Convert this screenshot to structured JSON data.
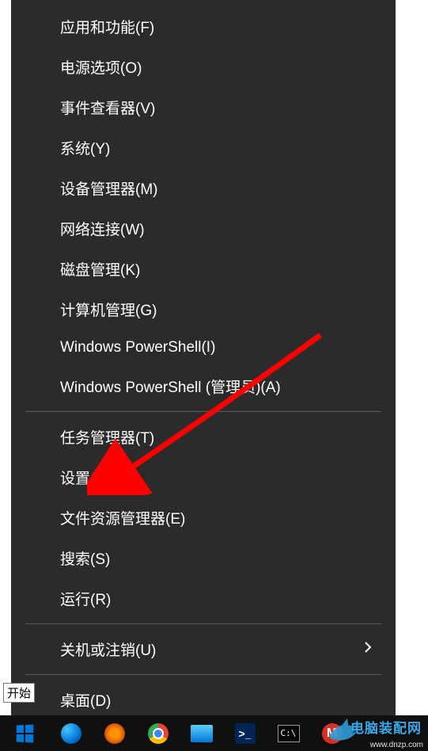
{
  "menu": {
    "groups": [
      [
        {
          "label": "应用和功能(F)"
        },
        {
          "label": "电源选项(O)"
        },
        {
          "label": "事件查看器(V)"
        },
        {
          "label": "系统(Y)"
        },
        {
          "label": "设备管理器(M)"
        },
        {
          "label": "网络连接(W)"
        },
        {
          "label": "磁盘管理(K)"
        },
        {
          "label": "计算机管理(G)"
        },
        {
          "label": "Windows PowerShell(I)"
        },
        {
          "label": "Windows PowerShell (管理员)(A)"
        }
      ],
      [
        {
          "label": "任务管理器(T)"
        },
        {
          "label": "设置(N)"
        },
        {
          "label": "文件资源管理器(E)"
        },
        {
          "label": "搜索(S)"
        },
        {
          "label": "运行(R)"
        }
      ],
      [
        {
          "label": "关机或注销(U)",
          "submenu": true
        }
      ],
      [
        {
          "label": "桌面(D)"
        }
      ]
    ]
  },
  "tooltip": "开始",
  "taskbar": {
    "ps_glyph": ">_",
    "term_glyph": "C:\\",
    "m_glyph": "M"
  },
  "watermark": {
    "brand": "电脑装配网",
    "url": "www.dnzp.com"
  }
}
